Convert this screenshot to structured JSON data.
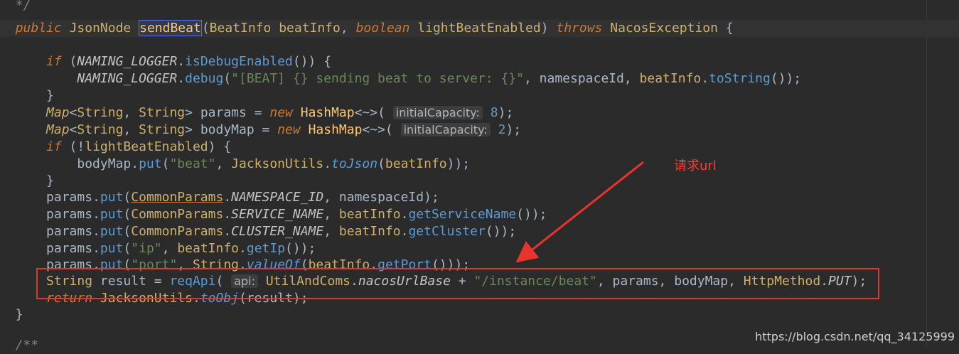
{
  "code": {
    "comment_top": "*/",
    "public_kw": "public",
    "ret_type": "JsonNode",
    "method_name": "sendBeat",
    "param1_type": "BeatInfo",
    "param1_name": "beatInfo",
    "param2_type": "boolean",
    "param2_name": "lightBeatEnabled",
    "throws_kw": "throws",
    "exception": "NacosException",
    "if_kw": "if",
    "logger": "NAMING_LOGGER",
    "is_debug": "isDebugEnabled",
    "debug": "debug",
    "debug_msg": "\"[BEAT] {} sending beat to server: {}\"",
    "namespace_id": "namespaceId",
    "beatinfo_var": "beatInfo",
    "to_string": "toString",
    "map_type": "Map",
    "string_type": "String",
    "params_var": "params",
    "new_kw": "new",
    "hashmap": "HashMap",
    "capacity_hint": "initialCapacity:",
    "cap8": "8",
    "bodymap_var": "bodyMap",
    "cap2": "2",
    "light_beat_var": "lightBeatEnabled",
    "put": "put",
    "beat_str": "\"beat\"",
    "jackson": "JacksonUtils",
    "to_json": "toJson",
    "common_params": "CommonParams",
    "namespace_const": "NAMESPACE_ID",
    "service_const": "SERVICE_NAME",
    "cluster_const": "CLUSTER_NAME",
    "get_service_name": "getServiceName",
    "get_cluster": "getCluster",
    "ip_str": "\"ip\"",
    "get_ip": "getIp",
    "port_str": "\"port\"",
    "value_of": "valueOf",
    "get_port": "getPort",
    "result_var": "result",
    "req_api": "reqApi",
    "api_hint": "api:",
    "util_coms": "UtilAndComs",
    "nacos_url_base": "nacosUrlBase",
    "instance_beat": "\"/instance/beat\"",
    "http_method": "HttpMethod",
    "put_const": "PUT",
    "return_kw": "return",
    "to_obj": "toObj",
    "comment_bottom": "/**"
  },
  "annotation": "请求url",
  "watermark": "https://blog.csdn.net/qq_34125999",
  "colors": {
    "background": "#2b2b2b",
    "keyword": "#cc7832",
    "annotation": "#ff3b30"
  }
}
